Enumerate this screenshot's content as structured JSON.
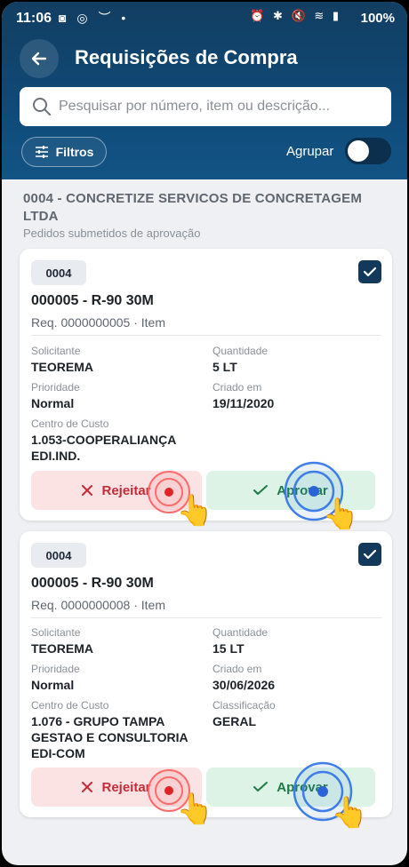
{
  "status_bar": {
    "time": "11:06",
    "left_icons": "◙ ◎ ︶ •",
    "right_icons": "⏰ ✱ 🔇 ≋ ▮",
    "battery": "100%"
  },
  "header": {
    "title": "Requisições de Compra",
    "search_placeholder": "Pesquisar por número, item ou descrição...",
    "filters_label": "Filtros",
    "group_label": "Agrupar",
    "group_enabled": false
  },
  "section": {
    "title": "0004 - CONCRETIZE SERVICOS DE CONCRETAGEM LTDA",
    "subtitle": "Pedidos submetidos de aprovação"
  },
  "cards": [
    {
      "badge": "0004",
      "title": "000005 - R-90 30M",
      "req": "Req. 0000000005 · Item",
      "checked": true,
      "requester_label": "Solicitante",
      "requester": "TEOREMA",
      "quantity_label": "Quantidade",
      "quantity": "5 LT",
      "priority_label": "Prioridade",
      "priority": "Normal",
      "created_label": "Criado em",
      "created": "19/11/2020",
      "cost_center_label": "Centro de Custo",
      "cost_center": "1.053-COOPERALIANÇA EDI.IND.",
      "reject_label": "Rejeitar",
      "approve_label": "Aprovar"
    },
    {
      "badge": "0004",
      "title": "000005 - R-90 30M",
      "req": "Req. 0000000008 · Item",
      "checked": true,
      "requester_label": "Solicitante",
      "requester": "TEOREMA",
      "quantity_label": "Quantidade",
      "quantity": "15 LT",
      "priority_label": "Prioridade",
      "priority": "Normal",
      "created_label": "Criado em",
      "created": "30/06/2026",
      "cost_center_label": "Centro de Custo",
      "cost_center": "1.076 - GRUPO TAMPA GESTAO E CONSULTORIA EDI-COM",
      "classification_label": "Classificação",
      "classification": "GERAL",
      "reject_label": "Rejeitar",
      "approve_label": "Aprovar"
    }
  ],
  "colors": {
    "header": "#0f4a78",
    "reject_bg": "#fbe3e4",
    "reject_text": "#c42b38",
    "approve_bg": "#dcf3e5",
    "approve_text": "#1f7a45",
    "checkbox": "#12395a"
  }
}
